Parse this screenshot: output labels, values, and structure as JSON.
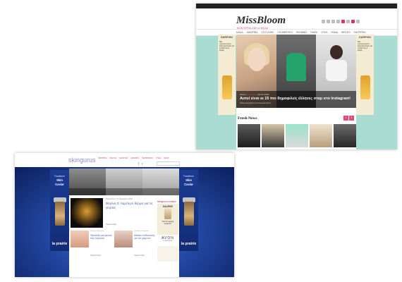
{
  "missbloom": {
    "logo": "MissBloom",
    "tagline": "ΜΟΝΤΕΡΝΑ ΖΩΗ & ΜΟΔΑ",
    "nav": [
      "ΜΟΔΑ",
      "ΟΜΟΡΦΙΑ",
      "ΣΤΥΛ ΖΩΗΣ",
      "CELEBRITIES",
      "SHOWBIZ",
      "ΓΑΜΟΙ",
      "ΥΓΕΙΑ",
      "ΖΩΔΙΑ",
      "ΒΙΝΤΕΟ",
      "SHOPPING"
    ],
    "ad_brand": "DARPHIN",
    "ad_text": "Νέα συμπυκνωμένα έλαια θεραπείας για ενυδάτωση & λάμψη",
    "hero": {
      "meta_author": "Team",
      "meta_category": "Celebrities",
      "meta_date": "24.11.2016",
      "headline": "Αυτοί είναι οι 15 πιο δημοφιλείς έλληνες σταρ στο Instagram!",
      "sub": "Ποιοι κυριαρχούν στο κοινωνικό δίκτυο"
    },
    "fresh_news": "Fresh News"
  },
  "skingurus": {
    "logo": "skingurus",
    "topnav": [
      "ΟΜΟΡΦΙΑ",
      "ΜΑΛΛΙΑ",
      "ΜΑΚΙΓΙΑΖ",
      "ΑΡΩΜΑΤΑ",
      "ΦΑΡΜΑΚΕΙΟ",
      "ΥΓΕΙΑ",
      "SHOP"
    ],
    "ad_left": {
      "line1": "Transform",
      "line2": "Skin",
      "line3": "Caviar",
      "brand": "la prairie"
    },
    "ad_right": {
      "line1": "Transform",
      "line2": "Skin",
      "line3": "Caviar",
      "brand": "la prairie"
    },
    "featured": {
      "meta": "Περιποίηση | 17 Νοεμβρίου 2016",
      "title": "Βιτρίνα 3: Λαμπερό δέρμα για τις γιορτές",
      "more": "Περισσότερα"
    },
    "side": {
      "header": "skingurus boutique",
      "brand1": "GALENIC",
      "brand1_text": "The first ageing treatment",
      "brand2": "AVON",
      "brand2_sub": "ΣΥΝΕΡΓΑΤΗΣ"
    },
    "cards": [
      {
        "meta": "Μαλλιά | Νοεμβρίου",
        "title": "Φροντίδα για μαλλιά που λάμπουν",
        "more": "Περισσότερα"
      },
      {
        "meta": "Ομορφιά | Νοεμβρίου",
        "title": "Μάσκα ενυδάτωσης για τον χειμώνα",
        "more": "Περισσότερα"
      }
    ]
  }
}
